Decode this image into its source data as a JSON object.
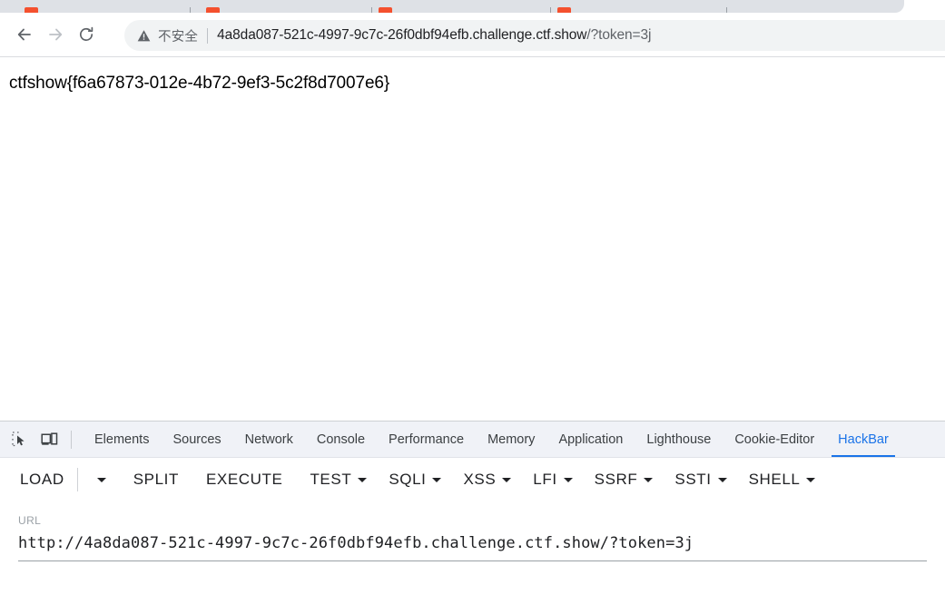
{
  "browser": {
    "nav": {
      "back_icon": "arrow-left-icon",
      "forward_icon": "arrow-right-icon",
      "reload_icon": "reload-icon"
    },
    "omnibox": {
      "security_icon": "warning-triangle-icon",
      "security_label": "不安全",
      "url_display_host": "4a8da087-521c-4997-9c7c-26f0dbf94efb.challenge.ctf.show",
      "url_display_path": "/?token=3j"
    },
    "tabstrip": {
      "favicon_color": "#f4502e",
      "background": "#dee1e6"
    }
  },
  "page": {
    "flag": "ctfshow{f6a67873-012e-4b72-9ef3-5c2f8d7007e6}"
  },
  "devtools": {
    "inspect_icon": "inspect-element-icon",
    "device_icon": "device-toolbar-icon",
    "active_tab": "HackBar",
    "accent_color": "#1a73e8",
    "tabs": [
      {
        "label": "Elements"
      },
      {
        "label": "Sources"
      },
      {
        "label": "Network"
      },
      {
        "label": "Console"
      },
      {
        "label": "Performance"
      },
      {
        "label": "Memory"
      },
      {
        "label": "Application"
      },
      {
        "label": "Lighthouse"
      },
      {
        "label": "Cookie-Editor"
      },
      {
        "label": "HackBar"
      }
    ]
  },
  "hackbar": {
    "buttons": [
      {
        "label": "LOAD",
        "caret": true
      },
      {
        "label": "SPLIT",
        "caret": false
      },
      {
        "label": "EXECUTE",
        "caret": false
      },
      {
        "label": "TEST",
        "caret": true
      },
      {
        "label": "SQLI",
        "caret": true
      },
      {
        "label": "XSS",
        "caret": true
      },
      {
        "label": "LFI",
        "caret": true
      },
      {
        "label": "SSRF",
        "caret": true
      },
      {
        "label": "SSTI",
        "caret": true
      },
      {
        "label": "SHELL",
        "caret": true
      }
    ],
    "url_field": {
      "label": "URL",
      "value": "http://4a8da087-521c-4997-9c7c-26f0dbf94efb.challenge.ctf.show/?token=3j",
      "placeholder": "URL"
    }
  }
}
